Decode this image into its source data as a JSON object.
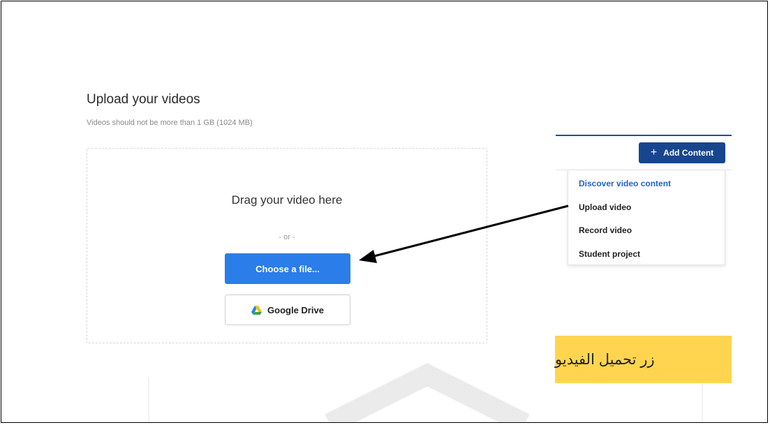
{
  "upload": {
    "title": "Upload your videos",
    "subtitle": "Videos should not be more than 1 GB (1024 MB)",
    "drag_text": "Drag your video here",
    "or_text": "- or -",
    "choose_label": "Choose a file...",
    "gdrive_label": "Google Drive",
    "gdrive_icon": "google-drive-icon"
  },
  "toolbar": {
    "add_label": "Add Content",
    "add_icon": "plus-icon"
  },
  "menu": {
    "items": [
      {
        "label": "Discover video content"
      },
      {
        "label": "Upload video"
      },
      {
        "label": "Record video"
      },
      {
        "label": "Student project"
      }
    ]
  },
  "annotation": {
    "label": "زر تحميل الفيديو"
  },
  "colors": {
    "primary": "#2b7de9",
    "add_button": "#17468f",
    "menu_accent": "#1f63c7",
    "annotation_bg": "#ffd54f"
  }
}
